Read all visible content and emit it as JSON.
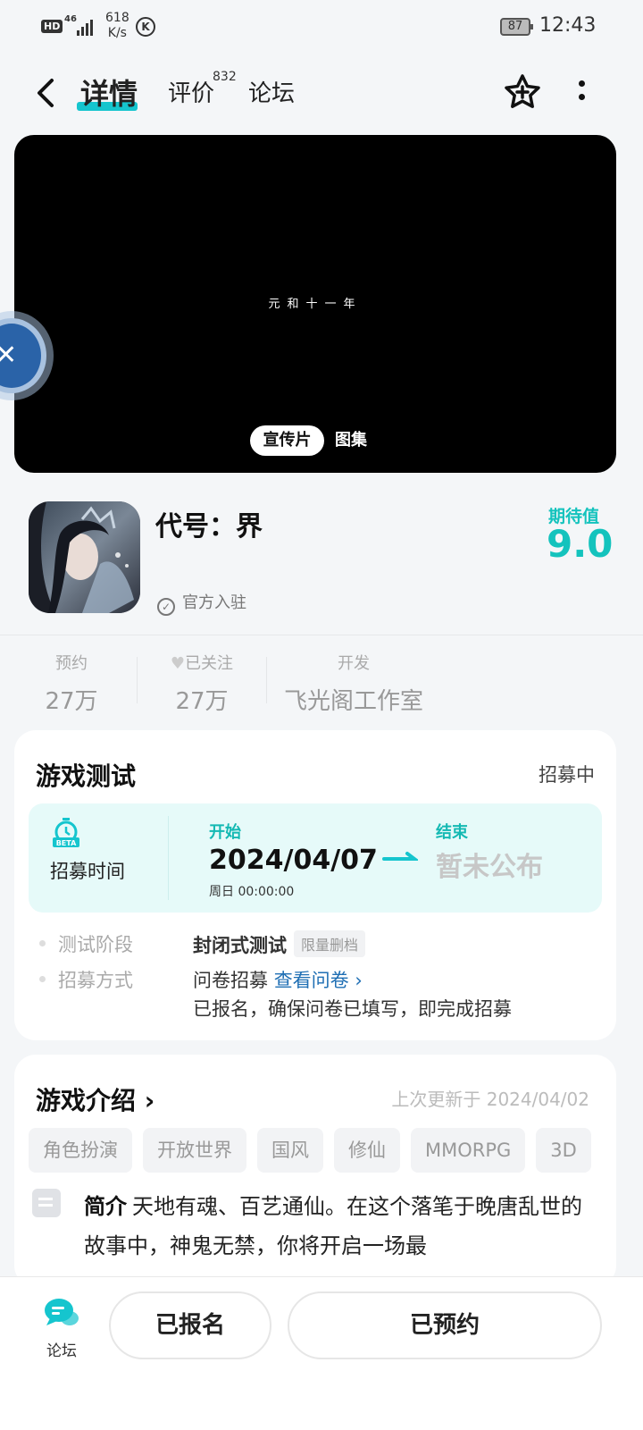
{
  "status_bar": {
    "hd": "HD",
    "network": "46",
    "speed_value": "618",
    "speed_unit": "K/s",
    "k_badge": "K",
    "battery": "87",
    "time": "12:43"
  },
  "nav": {
    "tabs": [
      {
        "label": "详情",
        "active": true
      },
      {
        "label": "评价",
        "badge": "832"
      },
      {
        "label": "论坛"
      }
    ],
    "icons": [
      "back-arrow-icon",
      "star-add-icon",
      "more-vertical-icon"
    ]
  },
  "media": {
    "caption": "元和十一年",
    "switch": {
      "promo": "宣传片",
      "gallery": "图集"
    }
  },
  "game": {
    "title": "代号：界",
    "official_label": "官方入驻",
    "expectation_label": "期待值",
    "expectation_value": "9.0"
  },
  "stats": [
    {
      "label": "预约",
      "value": "27万"
    },
    {
      "label": "已关注",
      "value": "27万"
    },
    {
      "label": "开发",
      "value": "飞光阁工作室"
    }
  ],
  "test_card": {
    "title": "游戏测试",
    "status": "招募中",
    "time_label": "招募时间",
    "icon_text": "BETA",
    "start_label": "开始",
    "start_date": "2024/04/07",
    "start_time": "周日  00:00:00",
    "end_label": "结束",
    "end_value": "暂未公布",
    "rows": {
      "stage_label": "测试阶段",
      "stage_value": "封闭式测试",
      "stage_tag": "限量删档",
      "method_label": "招募方式",
      "method_value": "问卷招募",
      "method_link": "查看问卷",
      "note": "已报名，确保问卷已填写，即完成招募"
    }
  },
  "intro_card": {
    "title": "游戏介绍",
    "updated": "上次更新于 2024/04/02",
    "tags": [
      "角色扮演",
      "开放世界",
      "国风",
      "修仙",
      "MMORPG",
      "3D"
    ],
    "summary_label": "简介",
    "summary_text": "天地有魂、百艺通仙。在这个落笔于晚唐乱世的故事中，神鬼无禁，你将开启一场最"
  },
  "bottom_bar": {
    "forum_label": "论坛",
    "signed_button": "已报名",
    "reserved_button": "已预约"
  },
  "colors": {
    "accent": "#15c5ce",
    "expectation": "#14c3bd",
    "link": "#1f6fb4"
  }
}
